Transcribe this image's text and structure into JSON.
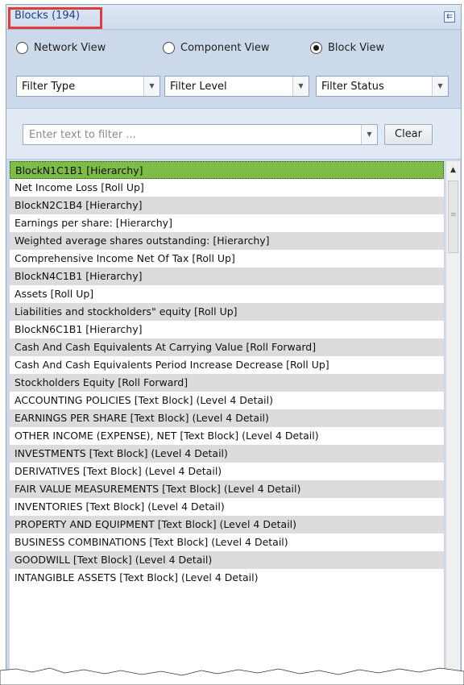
{
  "panel": {
    "title": "Blocks (194)",
    "pin_icon": "pin-icon"
  },
  "views": [
    {
      "label": "Network View",
      "selected": false
    },
    {
      "label": "Component View",
      "selected": false
    },
    {
      "label": "Block View",
      "selected": true
    }
  ],
  "filters": {
    "type": "Filter Type",
    "level": "Filter Level",
    "status": "Filter Status"
  },
  "text_filter": {
    "placeholder": "Enter text to filter ...",
    "clear_label": "Clear"
  },
  "list": {
    "items": [
      "BlockN1C1B1 [Hierarchy]",
      "Net Income Loss [Roll Up]",
      "BlockN2C1B4 [Hierarchy]",
      "Earnings per share: [Hierarchy]",
      "Weighted average shares outstanding: [Hierarchy]",
      "Comprehensive Income Net Of Tax [Roll Up]",
      "BlockN4C1B1 [Hierarchy]",
      "Assets [Roll Up]",
      "Liabilities and stockholders\" equity [Roll Up]",
      "BlockN6C1B1 [Hierarchy]",
      "Cash And Cash Equivalents At Carrying Value [Roll Forward]",
      "Cash And Cash Equivalents Period Increase Decrease [Roll Up]",
      "Stockholders Equity [Roll Forward]",
      "ACCOUNTING POLICIES [Text Block] (Level 4 Detail)",
      "EARNINGS PER SHARE [Text Block] (Level 4 Detail)",
      "OTHER INCOME (EXPENSE), NET [Text Block] (Level 4 Detail)",
      "INVESTMENTS [Text Block] (Level 4 Detail)",
      "DERIVATIVES [Text Block] (Level 4 Detail)",
      "FAIR VALUE MEASUREMENTS [Text Block] (Level 4 Detail)",
      "INVENTORIES [Text Block] (Level 4 Detail)",
      "PROPERTY AND EQUIPMENT [Text Block] (Level 4 Detail)",
      "BUSINESS COMBINATIONS [Text Block] (Level 4 Detail)",
      "GOODWILL [Text Block] (Level 4 Detail)",
      "INTANGIBLE ASSETS [Text Block] (Level 4 Detail)"
    ],
    "selected_index": 0
  },
  "colors": {
    "selected_row": "#7fbc47",
    "annotation_box": "#e23a3a",
    "panel_bg": "#ccd9ea"
  }
}
